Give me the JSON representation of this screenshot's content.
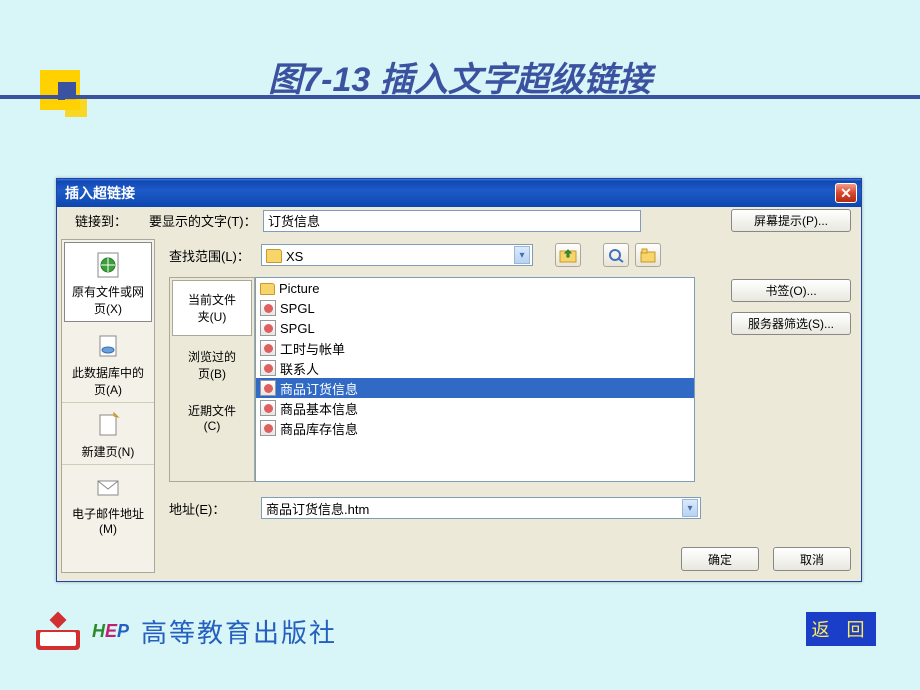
{
  "page": {
    "title": "图7-13  插入文字超级链接"
  },
  "dialog": {
    "title": "插入超链接",
    "link_to_label": "链接到：",
    "display_label": "要显示的文字(T)：",
    "display_value": "订货信息",
    "screen_tip": "屏幕提示(P)...",
    "look_in_label": "查找范围(L)：",
    "look_in_value": "XS",
    "address_label": "地址(E)：",
    "address_value": "商品订货信息.htm",
    "ok": "确定",
    "cancel": "取消"
  },
  "link_targets": [
    {
      "label": "原有文件或网\n页(X)"
    },
    {
      "label": "此数据库中的\n页(A)"
    },
    {
      "label": "新建页(N)"
    },
    {
      "label": "电子邮件地址\n(M)"
    }
  ],
  "mid_tabs": [
    {
      "label": "当前文件\n夹(U)"
    },
    {
      "label": "浏览过的\n页(B)"
    },
    {
      "label": "近期文件\n(C)"
    }
  ],
  "files": [
    {
      "name": "Picture",
      "type": "folder"
    },
    {
      "name": "SPGL",
      "type": "page"
    },
    {
      "name": "SPGL",
      "type": "page"
    },
    {
      "name": "工时与帐单",
      "type": "page"
    },
    {
      "name": "联系人",
      "type": "page"
    },
    {
      "name": "商品订货信息",
      "type": "page",
      "selected": true
    },
    {
      "name": "商品基本信息",
      "type": "page"
    },
    {
      "name": "商品库存信息",
      "type": "page"
    }
  ],
  "right_buttons": {
    "bookmark": "书签(O)...",
    "server_filter": "服务器筛选(S)..."
  },
  "footer": {
    "publisher": "高等教育出版社",
    "back": "返 回"
  }
}
